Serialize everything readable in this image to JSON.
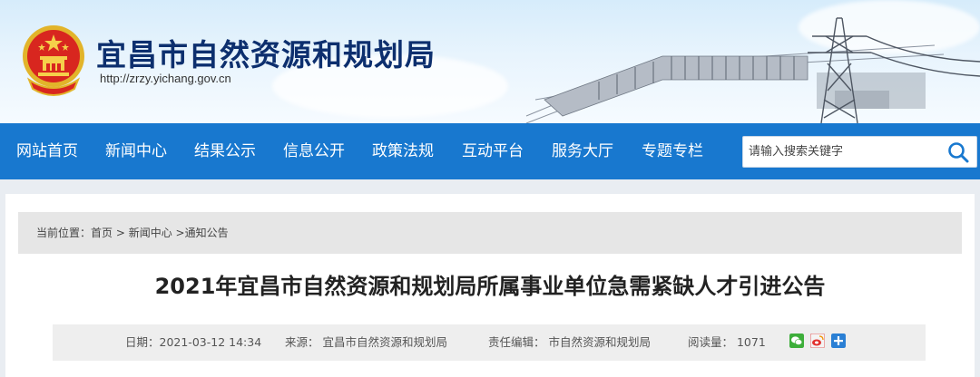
{
  "header": {
    "title": "宜昌市自然资源和规划局",
    "url": "http://zrzy.yichang.gov.cn",
    "emblem_icon": "national-emblem-icon",
    "banner_art": "three-gorges-dam-and-pylon-illustration"
  },
  "nav": {
    "items": [
      "网站首页",
      "新闻中心",
      "结果公示",
      "信息公开",
      "政策法规",
      "互动平台",
      "服务大厅",
      "专题专栏"
    ],
    "bg_color": "#1878cf"
  },
  "search": {
    "placeholder": "请输入搜索关键字",
    "icon": "search-icon"
  },
  "breadcrumb": {
    "prefix": "当前位置：",
    "home": "首页",
    "sep1": " > ",
    "news": "新闻中心",
    "sep2": " >",
    "current": "通知公告"
  },
  "article": {
    "title": "2021年宜昌市自然资源和规划局所属事业单位急需紧缺人才引进公告",
    "date_label": "日期：2021-03-12 14:34",
    "source_label": "来源：  宜昌市自然资源和规划局",
    "editor_label": "责任编辑：  市自然资源和规划局",
    "views_label": "阅读量：  1071"
  },
  "share": {
    "icons": [
      "wechat-share-icon",
      "weibo-share-icon",
      "more-share-icon"
    ]
  }
}
